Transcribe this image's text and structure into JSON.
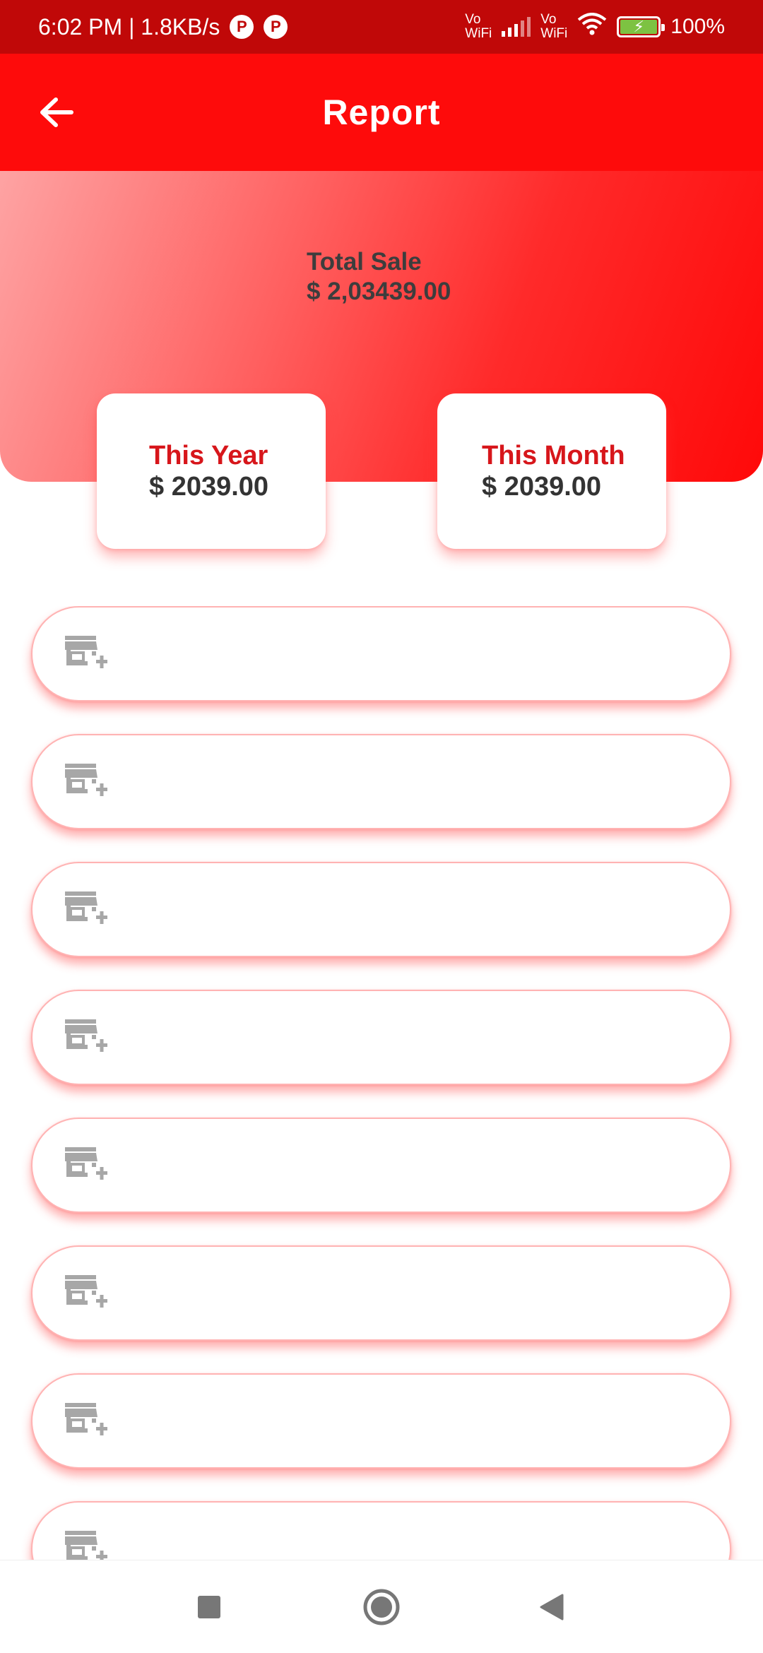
{
  "status_bar": {
    "time_speed": "6:02 PM | 1.8KB/s",
    "vowifi_1": "Vo\nWiFi",
    "vowifi_2": "Vo\nWiFi",
    "battery_percent": "100%",
    "battery_level": 1.0
  },
  "app_bar": {
    "title": "Report",
    "back_icon": "arrow-left-icon"
  },
  "header": {
    "total_sale_label": "Total Sale",
    "total_sale_value": "$ 2,03439.00"
  },
  "summary": {
    "year": {
      "label": "This Year",
      "value": "$ 2039.00"
    },
    "month": {
      "label": "This Month",
      "value": "$ 2039.00"
    }
  },
  "list": {
    "item_icon": "store-add-icon",
    "items": [
      {},
      {},
      {},
      {},
      {},
      {},
      {},
      {}
    ]
  },
  "nav_bar": {
    "recents_icon": "square-icon",
    "home_icon": "circle-home-icon",
    "back_icon": "triangle-back-icon"
  },
  "colors": {
    "status_bar": "#c00808",
    "app_bar": "#fe0b0b",
    "accent_text": "#d7161b",
    "card_shadow": "#ff5050"
  }
}
